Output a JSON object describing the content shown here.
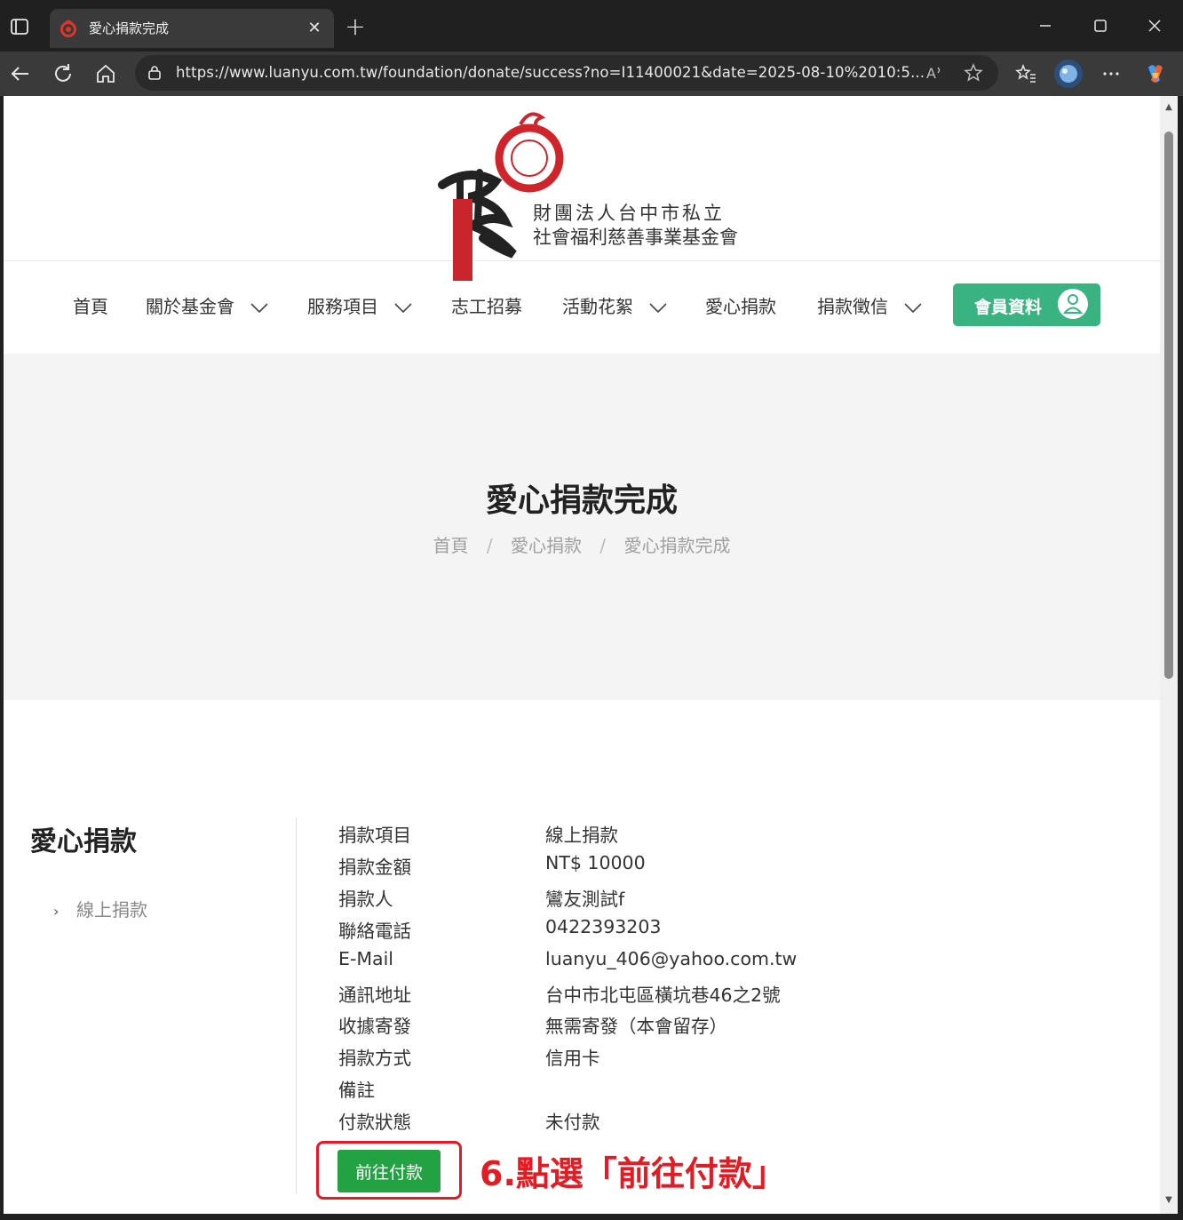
{
  "browser": {
    "tab_title": "愛心捐款完成",
    "tab_close": "✕",
    "new_tab": "+",
    "url": "https://www.luanyu.com.tw/foundation/donate/success?no=I11400021&date=2025-08-10%2010:5..."
  },
  "site": {
    "logo_line1": "財團法人台中市私立",
    "logo_line2": "社會福利慈善事業基金會",
    "nav": [
      {
        "label": "首頁"
      },
      {
        "label": "關於基金會"
      },
      {
        "label": "服務項目"
      },
      {
        "label": "志工招募"
      },
      {
        "label": "活動花絮"
      },
      {
        "label": "愛心捐款"
      },
      {
        "label": "捐款徵信"
      }
    ],
    "member_button": "會員資料"
  },
  "hero": {
    "title": "愛心捐款完成",
    "breadcrumb": [
      "首頁",
      "愛心捐款",
      "愛心捐款完成"
    ],
    "sep": "/"
  },
  "sidebar": {
    "title": "愛心捐款",
    "items": [
      {
        "label": "線上捐款",
        "arrow": "›"
      }
    ]
  },
  "details": [
    {
      "label": "捐款項目",
      "value": "線上捐款"
    },
    {
      "label": "捐款金額",
      "value": "NT$ 10000"
    },
    {
      "label": "捐款人",
      "value": "鸞友測試f"
    },
    {
      "label": "聯絡電話",
      "value": "0422393203"
    },
    {
      "label": "E-Mail",
      "value": "luanyu_406@yahoo.com.tw"
    },
    {
      "label": "通訊地址",
      "value": "台中市北屯區橫坑巷46之2號"
    },
    {
      "label": "收據寄發",
      "value": "無需寄發（本會留存）"
    },
    {
      "label": "捐款方式",
      "value": "信用卡"
    },
    {
      "label": "備註",
      "value": ""
    },
    {
      "label": "付款狀態",
      "value": "未付款"
    }
  ],
  "pay_button": "前往付款",
  "annotation": "6.點選「前往付款」",
  "colors": {
    "accent_green": "#3ab383",
    "pay_green": "#22a243",
    "annotation_red": "#e31b23"
  }
}
